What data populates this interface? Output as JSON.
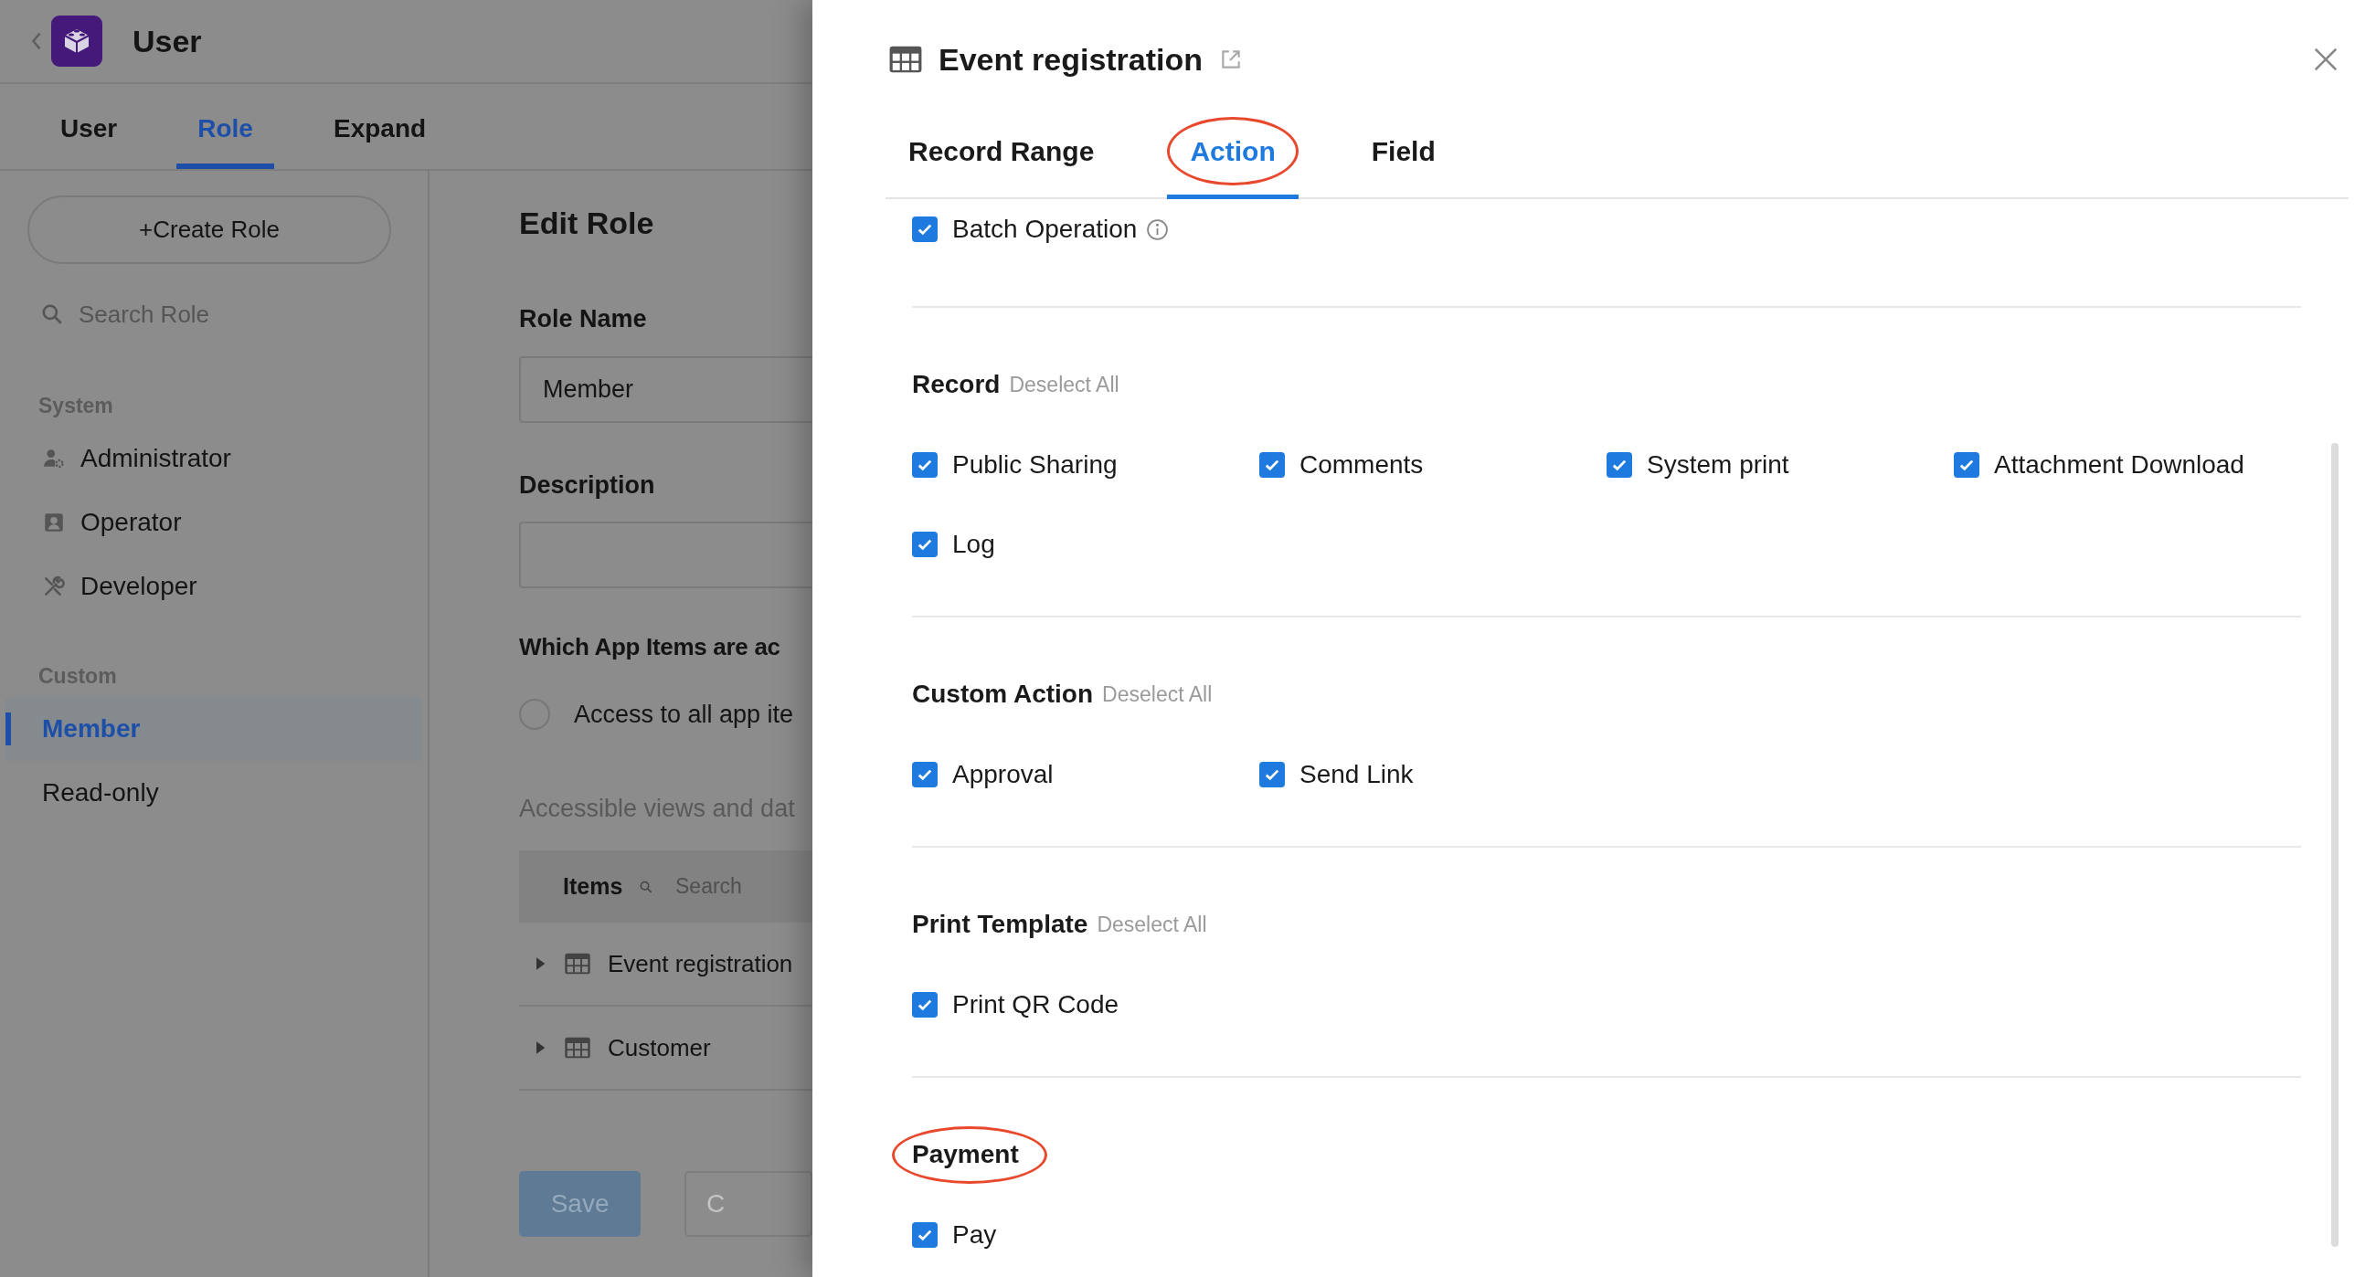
{
  "header": {
    "title": "User"
  },
  "tabs": [
    {
      "label": "User",
      "selected": false
    },
    {
      "label": "Role",
      "selected": true
    },
    {
      "label": "Expand",
      "selected": false
    }
  ],
  "sidebar": {
    "create_button": "+Create Role",
    "search_placeholder": "Search Role",
    "groups": [
      {
        "title": "System",
        "items": [
          {
            "label": "Administrator",
            "selected": false
          },
          {
            "label": "Operator",
            "selected": false
          },
          {
            "label": "Developer",
            "selected": false
          }
        ]
      },
      {
        "title": "Custom",
        "items": [
          {
            "label": "Member",
            "selected": true
          },
          {
            "label": "Read-only",
            "selected": false
          }
        ]
      }
    ]
  },
  "editor": {
    "title": "Edit Role",
    "role_name_label": "Role Name",
    "role_name_value": "Member",
    "description_label": "Description",
    "access_label": "Which App Items are ac",
    "access_option": {
      "label": "Access to all app ite",
      "selected": false
    },
    "views_label": "Accessible views and dat",
    "items_header": {
      "label": "Items",
      "search_placeholder": "Search"
    },
    "items": [
      {
        "label": "Event registration",
        "expanded": false
      },
      {
        "label": "Customer",
        "expanded": false
      }
    ],
    "buttons": [
      "Save",
      "C"
    ]
  },
  "drawer": {
    "title": "Event registration",
    "tabs": [
      {
        "label": "Record Range",
        "selected": false,
        "circled": false
      },
      {
        "label": "Action",
        "selected": true,
        "circled": true
      },
      {
        "label": "Field",
        "selected": false,
        "circled": false
      }
    ],
    "sections": [
      {
        "options": [
          {
            "label": "Batch Operation",
            "checked": true,
            "info": true
          }
        ],
        "circled": false
      },
      {
        "title": "Record",
        "action": "Deselect All",
        "circled": false,
        "options": [
          {
            "label": "Public Sharing",
            "checked": true
          },
          {
            "label": "Comments",
            "checked": true
          },
          {
            "label": "System print",
            "checked": true
          },
          {
            "label": "Attachment Download",
            "checked": true
          },
          {
            "label": "Log",
            "checked": true
          }
        ]
      },
      {
        "title": "Custom Action",
        "action": "Deselect All",
        "circled": false,
        "options": [
          {
            "label": "Approval",
            "checked": true
          },
          {
            "label": "Send Link",
            "checked": true
          }
        ]
      },
      {
        "title": "Print Template",
        "action": "Deselect All",
        "circled": false,
        "options": [
          {
            "label": "Print QR Code",
            "checked": true
          }
        ]
      },
      {
        "title": "Payment",
        "circled": true,
        "options": [
          {
            "label": "Pay",
            "checked": true
          }
        ]
      }
    ]
  }
}
